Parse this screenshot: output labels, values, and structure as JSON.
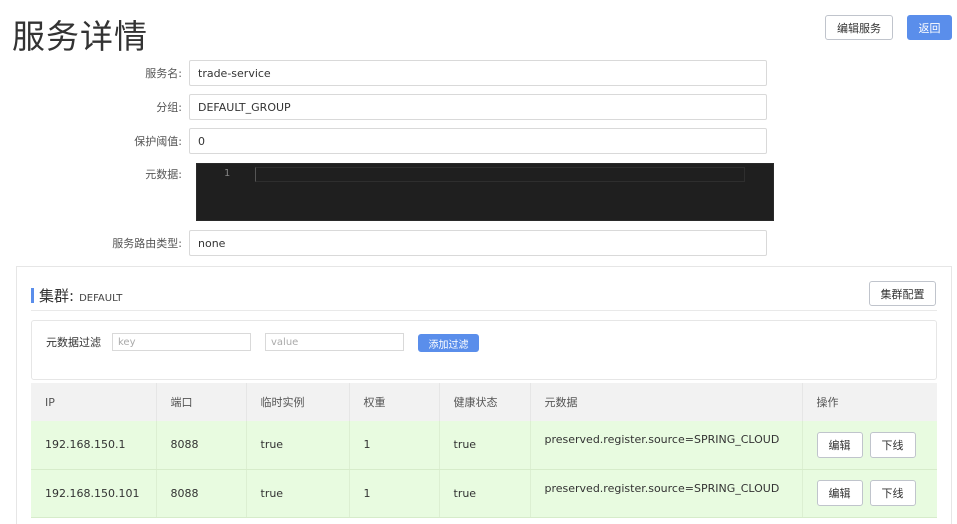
{
  "header": {
    "title": "服务详情",
    "edit_service_label": "编辑服务",
    "back_label": "返回"
  },
  "form": {
    "service_name": {
      "label": "服务名:",
      "value": "trade-service"
    },
    "group": {
      "label": "分组:",
      "value": "DEFAULT_GROUP"
    },
    "protect_threshold": {
      "label": "保护阈值:",
      "value": "0"
    },
    "metadata": {
      "label": "元数据:",
      "line_number": "1",
      "value": ""
    },
    "selector_type": {
      "label": "服务路由类型:",
      "value": "none"
    }
  },
  "cluster": {
    "title": "集群:",
    "name": "DEFAULT",
    "config_label": "集群配置",
    "filter": {
      "label": "元数据过滤",
      "key_placeholder": "key",
      "value_placeholder": "value",
      "add_label": "添加过滤"
    },
    "table": {
      "columns": [
        "IP",
        "端口",
        "临时实例",
        "权重",
        "健康状态",
        "元数据",
        "操作"
      ],
      "rows": [
        {
          "ip": "192.168.150.1",
          "port": "8088",
          "ephemeral": "true",
          "weight": "1",
          "healthy": "true",
          "metadata": "preserved.register.source=SPRING_CLOUD",
          "edit_label": "编辑",
          "offline_label": "下线"
        },
        {
          "ip": "192.168.150.101",
          "port": "8088",
          "ephemeral": "true",
          "weight": "1",
          "healthy": "true",
          "metadata": "preserved.register.source=SPRING_CLOUD",
          "edit_label": "编辑",
          "offline_label": "下线"
        }
      ]
    }
  },
  "colors": {
    "primary": "#5a8eeb",
    "row_healthy_bg": "#e8fbe0",
    "editor_bg": "#1f1f1f"
  }
}
